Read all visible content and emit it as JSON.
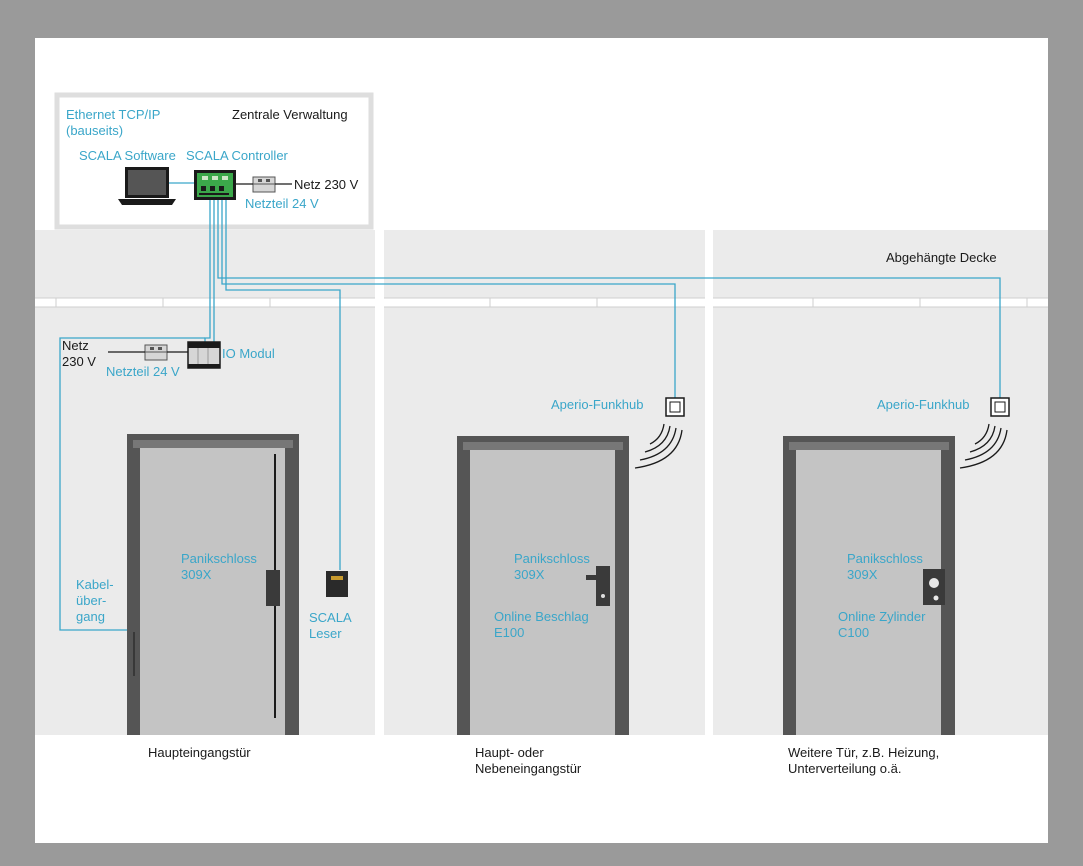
{
  "central": {
    "ethernet_line1": "Ethernet TCP/IP",
    "ethernet_line2": "(bauseits)",
    "title": "Zentrale Verwaltung",
    "software": "SCALA Software",
    "controller": "SCALA Controller",
    "mains": "Netz 230 V",
    "psu": "Netzteil 24 V"
  },
  "ceiling_label": "Abgehängte Decke",
  "room1": {
    "mains_line1": "Netz",
    "mains_line2": "230 V",
    "psu": "Netzteil 24 V",
    "io_module": "IO Modul",
    "lock_line1": "Panikschloss",
    "lock_line2": "309X",
    "cable_line1": "Kabel-",
    "cable_line2": "über-",
    "cable_line3": "gang",
    "reader_line1": "SCALA",
    "reader_line2": "Leser",
    "caption": "Haupteingangstür"
  },
  "room2": {
    "hub": "Aperio-Funkhub",
    "lock_line1": "Panikschloss",
    "lock_line2": "309X",
    "fitting_line1": "Online Beschlag",
    "fitting_line2": "E100",
    "caption_line1": "Haupt- oder",
    "caption_line2": "Nebeneingangstür"
  },
  "room3": {
    "hub": "Aperio-Funkhub",
    "lock_line1": "Panikschloss",
    "lock_line2": "309X",
    "cylinder_line1": "Online Zylinder",
    "cylinder_line2": "C100",
    "caption_line1": "Weitere Tür, z.B. Heizung,",
    "caption_line2": "Unterverteilung o.ä."
  },
  "colors": {
    "frame": "#9a9a9a",
    "canvas": "#ffffff",
    "wall": "#ebebeb",
    "door": "#c4c4c4",
    "door_frame": "#555555",
    "cable": "#3aa6c9"
  }
}
